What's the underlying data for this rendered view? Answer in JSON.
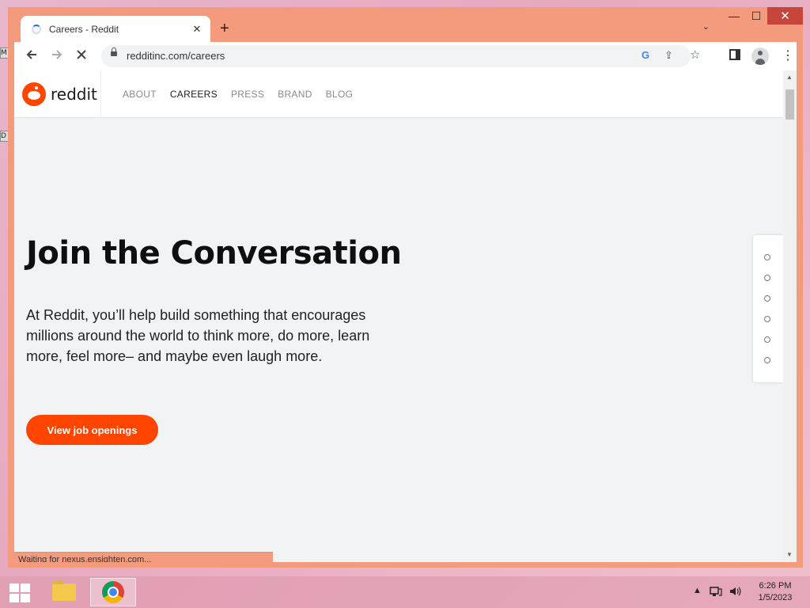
{
  "desktop": {
    "icon_labels": [
      "M",
      "D"
    ]
  },
  "browser": {
    "tab_title": "Careers - Reddit",
    "tab_close": "✕",
    "new_tab": "+",
    "tab_dropdown": "⌄",
    "url": "redditinc.com/careers",
    "status_text": "Waiting for nexus.ensighten.com...",
    "window_controls": {
      "minimize": "—",
      "maximize": "☐",
      "close": "✕"
    }
  },
  "site": {
    "logo_text": "reddit",
    "nav": [
      {
        "label": "ABOUT",
        "active": false
      },
      {
        "label": "CAREERS",
        "active": true
      },
      {
        "label": "PRESS",
        "active": false
      },
      {
        "label": "BRAND",
        "active": false
      },
      {
        "label": "BLOG",
        "active": false
      }
    ],
    "hero": {
      "title": "Join the Conversation",
      "body": "At Reddit, you’ll help build something that encourages millions around the world to think more, do more, learn more, feel more– and maybe even laugh more.",
      "cta": "View job openings"
    },
    "slide_dots_count": 6
  },
  "taskbar": {
    "time": "6:26 PM",
    "date": "1/5/2023"
  },
  "colors": {
    "brand": "#ff4500",
    "window_frame": "#f39b7c"
  }
}
